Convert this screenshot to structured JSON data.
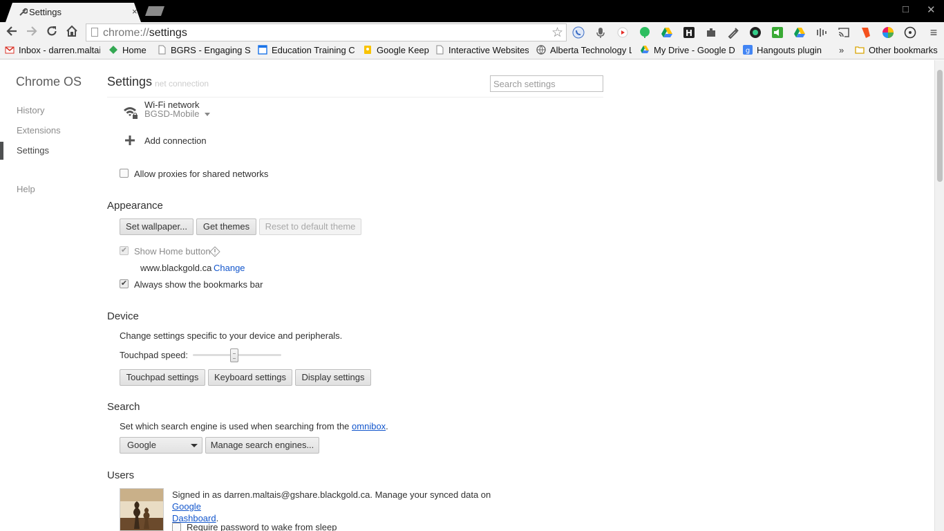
{
  "tab": {
    "title": "Settings",
    "icon": "wrench-icon",
    "close": "×"
  },
  "window": {
    "restore": "□",
    "close": "✕"
  },
  "omnibox": {
    "scheme": "chrome://",
    "host": "settings"
  },
  "bookmarks": [
    {
      "label": "Inbox - darren.maltai",
      "icon": "gmail-icon",
      "color": "#d93025"
    },
    {
      "label": "Home",
      "icon": "home-bookmark-icon",
      "color": "#34a853"
    },
    {
      "label": "BGRS - Engaging Stud",
      "icon": "page-icon",
      "color": "#888888"
    },
    {
      "label": "Education Training Co",
      "icon": "calendar-icon",
      "color": "#1a73e8"
    },
    {
      "label": "Google Keep",
      "icon": "keep-icon",
      "color": "#f9c300"
    },
    {
      "label": "Interactive Websites",
      "icon": "page-icon",
      "color": "#888888"
    },
    {
      "label": "Alberta Technology L",
      "icon": "globe-icon",
      "color": "#666666"
    },
    {
      "label": "My Drive - Google Dr",
      "icon": "drive-icon",
      "color": "#0f9d58"
    },
    {
      "label": "Hangouts plugin",
      "icon": "google-plus-icon",
      "color": "#4285f4"
    }
  ],
  "bookmarks_more": "»",
  "other_bookmarks": "Other bookmarks",
  "sidebar": {
    "title": "Chrome OS",
    "items": [
      "History",
      "Extensions",
      "Settings"
    ],
    "help": "Help"
  },
  "header": {
    "title": "Settings",
    "ghost": "Internet connection",
    "search_placeholder": "Search settings"
  },
  "internet": {
    "wifi_label": "Wi-Fi network",
    "wifi_network": "BGSD-Mobile",
    "add_connection": "Add connection",
    "allow_proxies": "Allow proxies for shared networks"
  },
  "appearance": {
    "title": "Appearance",
    "set_wallpaper": "Set wallpaper...",
    "get_themes": "Get themes",
    "reset_theme": "Reset to default theme",
    "show_home": "Show Home button",
    "home_url": "www.blackgold.ca",
    "change": "Change",
    "always_bookmarks": "Always show the bookmarks bar"
  },
  "device": {
    "title": "Device",
    "description": "Change settings specific to your device and peripherals.",
    "touchpad_speed": "Touchpad speed:",
    "touchpad_speed_level": 0.47,
    "touchpad_settings": "Touchpad settings",
    "keyboard_settings": "Keyboard settings",
    "display_settings": "Display settings"
  },
  "search": {
    "title": "Search",
    "description_before": "Set which search engine is used when searching from the ",
    "omnibox_link": "omnibox",
    "description_after": ".",
    "engine": "Google",
    "manage": "Manage search engines..."
  },
  "users": {
    "title": "Users",
    "signed_in": "Signed in as darren.maltais@gshare.blackgold.ca. Manage your synced data on ",
    "dashboard_link_1": "Google",
    "dashboard_link_2": "Dashboard",
    "period": ".",
    "require_password": "Require password to wake from sleep"
  }
}
